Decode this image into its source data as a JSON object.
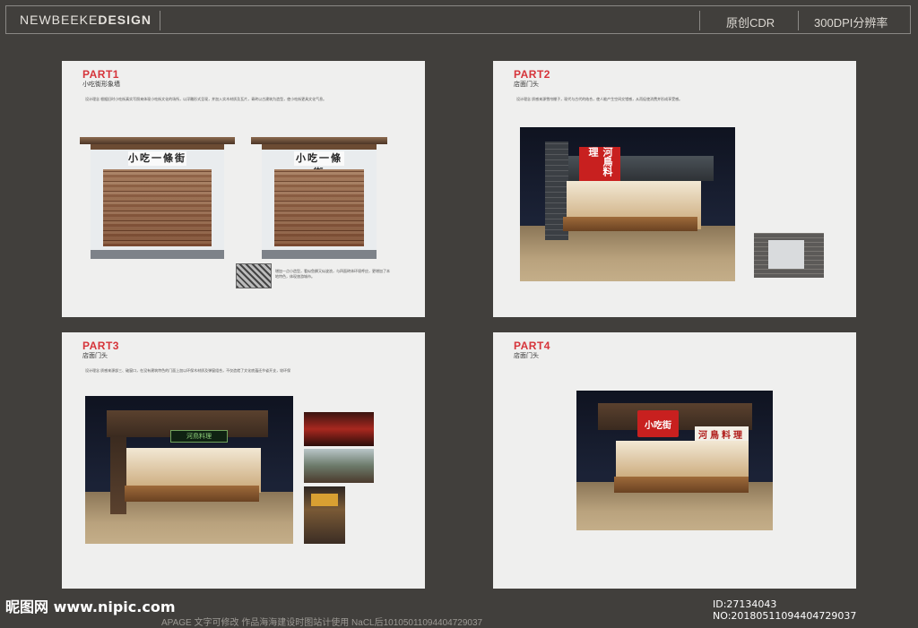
{
  "header": {
    "brand_light": "NEWBEEKE",
    "brand_bold": "DESIGN",
    "original_label": "原创CDR",
    "dpi_label": "300DPI分辨率"
  },
  "cards": [
    {
      "part": "PART1",
      "subtitle": "小吃街形象墙",
      "note": "设计理念\n根据旧时小吃街真实写照来体现小吃街文化的场所，以浮雕形式呈现，并加入实木材质及瓦片，青砖以古建筑为造型，使小吃街更具文化气息。",
      "sign": "小吃一條街",
      "side_note": "增加一点小造型，看似鱼鳞又似波浪，与四面砖体环境呼应，更增加了本地特色，体现旅游城市。"
    },
    {
      "part": "PART2",
      "subtitle": "店面门头",
      "note": "设计理念\n质感来源雪帘棚子，现代与古代的结合，使人能产生空间交错感，从而促使消费并形成享受感。",
      "sign": "河鳥料理"
    },
    {
      "part": "PART3",
      "subtitle": "店面门头",
      "note": "设计理念\n质感来源部三、破窗口，在没有建筑特色的门面上加以环保木材质及弹窗组合，不仅造就了文化底蕴还节省开支，较环保",
      "sign": "河鳥料理"
    },
    {
      "part": "PART4",
      "subtitle": "店面门头",
      "sign_red": "小吃街",
      "sign": "河鳥料理"
    }
  ],
  "watermark": {
    "site": "昵图网 www.nipic.com",
    "id_line": "ID:27134043 NO:20180511094404729037",
    "bottom": "APAGE 文字可修改  作品海海建设时图站计使用 NaCL后10105011094404729037"
  }
}
